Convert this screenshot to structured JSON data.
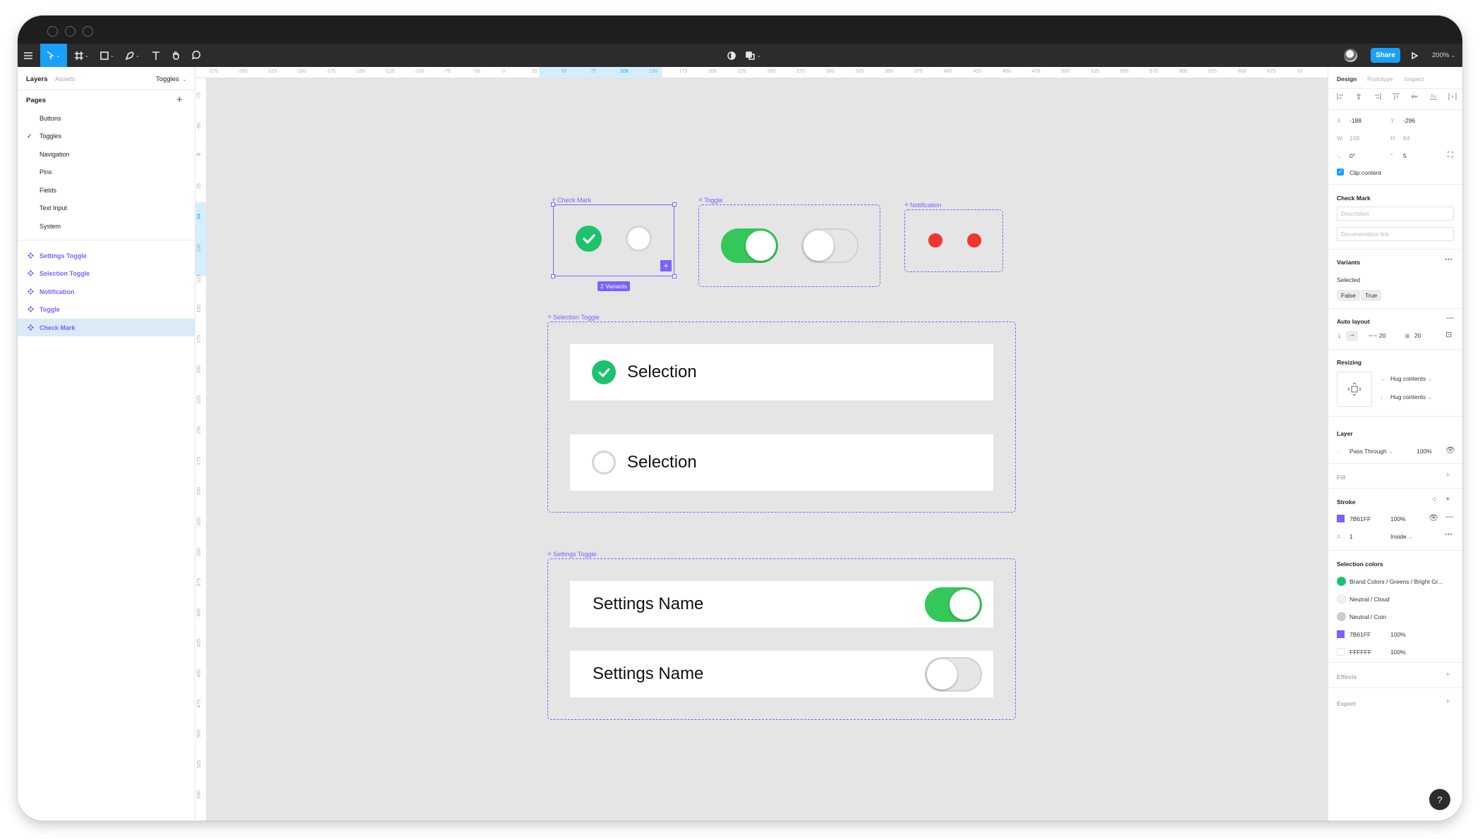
{
  "toolbar": {
    "share_label": "Share",
    "zoom": "200%"
  },
  "left_panel": {
    "tabs": [
      "Layers",
      "Assets"
    ],
    "current_page_selector": "Toggles",
    "pages_title": "Pages",
    "pages": [
      "Buttons",
      "Toggles",
      "Navigation",
      "Pins",
      "Fields",
      "Text Input",
      "System"
    ],
    "current_page": "Toggles",
    "layers": [
      "Settings Toggle",
      "Selection Toggle",
      "Notification",
      "Toggle",
      "Check Mark"
    ],
    "selected_layer": "Check Mark"
  },
  "ruler": {
    "top": [
      "-275",
      "-250",
      "-225",
      "-200",
      "-175",
      "-150",
      "-125",
      "-100",
      "-75",
      "-50",
      "0",
      "25",
      "50",
      "75",
      "108",
      "150",
      "175",
      "200",
      "225",
      "250",
      "275",
      "300",
      "325",
      "350",
      "375",
      "400",
      "425",
      "450",
      "475",
      "500",
      "525",
      "550",
      "575",
      "600",
      "625",
      "650",
      "675",
      "70"
    ],
    "left": [
      "-75",
      "-50",
      "0",
      "25",
      "64",
      "100",
      "125",
      "150",
      "175",
      "200",
      "225",
      "250",
      "275",
      "300",
      "325",
      "350",
      "375",
      "400",
      "425",
      "450",
      "475",
      "500",
      "525",
      "550"
    ]
  },
  "canvas": {
    "check_mark_label": "Check Mark",
    "variants_badge": "2 Variants",
    "toggle_label": "Toggle",
    "notification_label": "Notification",
    "selection_toggle_label": "Selection Toggle",
    "selection_rows": [
      "Selection",
      "Selection"
    ],
    "settings_toggle_label": "Settings Toggle",
    "settings_rows": [
      "Settings Name",
      "Settings Name"
    ]
  },
  "right_panel": {
    "tabs": [
      "Design",
      "Prototype",
      "Inspect"
    ],
    "x": "-188",
    "y": "-296",
    "w": "108",
    "h": "64",
    "rotation": "0°",
    "radius": "5",
    "clip_content": "Clip content",
    "component_name": "Check Mark",
    "description_placeholder": "Description",
    "doc_link_placeholder": "Documentation link",
    "variants_title": "Variants",
    "variant_property": "Selected",
    "variant_values": [
      "False",
      "True"
    ],
    "auto_layout_title": "Auto layout",
    "spacing": "20",
    "padding": "20",
    "resizing_title": "Resizing",
    "hug_h": "Hug contents",
    "hug_v": "Hug contents",
    "layer_title": "Layer",
    "blend_mode": "Pass Through",
    "layer_opacity": "100%",
    "fill_title": "Fill",
    "stroke_title": "Stroke",
    "stroke_color": "7B61FF",
    "stroke_opacity": "100%",
    "stroke_weight": "1",
    "stroke_position": "Inside",
    "selection_colors_title": "Selection colors",
    "selection_colors": [
      {
        "name": "Brand Colors / Greens / Bright Gr...",
        "color": "#1ec26d"
      },
      {
        "name": "Neutral / Cloud",
        "color": "#f2f2f2"
      },
      {
        "name": "Neutral / Coin",
        "color": "#cccccc"
      },
      {
        "name": "7B61FF",
        "opacity": "100%",
        "color": "#7b61ff"
      },
      {
        "name": "FFFFFF",
        "opacity": "100%",
        "color": "#ffffff"
      }
    ],
    "effects_title": "Effects",
    "export_title": "Export",
    "help": "?"
  },
  "colors": {
    "accent": "#7b61ff",
    "blue": "#18a0fb",
    "green": "#1ec26d",
    "red": "#f0342e"
  }
}
